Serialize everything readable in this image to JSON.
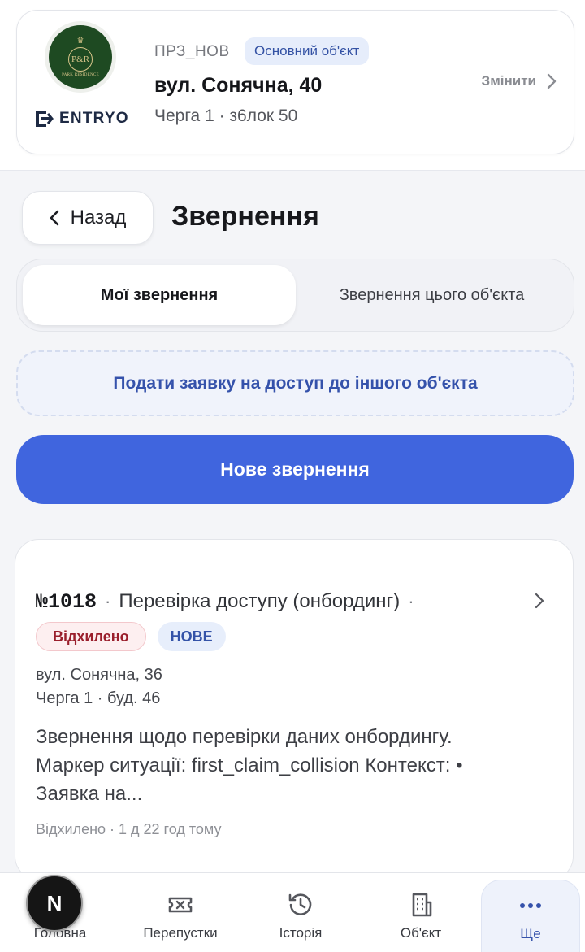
{
  "header": {
    "brand_logo_text": "P&R",
    "brand_logo_sub": "PARK RESIDENCE",
    "platform_name": "ENTRYO",
    "object_code": "ПРЗ_НОВ",
    "object_badge": "Основний об'єкт",
    "address": "вул. Сонячна, 40",
    "queue": "Черга 1 · з6лок 50",
    "change_label": "Змінити"
  },
  "title_bar": {
    "back_label": "Назад",
    "title": "Звернення"
  },
  "tabs": [
    {
      "label": "Мої звернення",
      "active": true
    },
    {
      "label": "Звернення цього об'єкта",
      "active": false
    }
  ],
  "access_link": "Подати заявку на доступ до іншого об'єкта",
  "new_request_label": "Нове звернення",
  "request": {
    "number": "№1018",
    "separator": "·",
    "type": "Перевірка доступу (онбординг)",
    "trailing_separator": "·",
    "status_badge": "Відхилено",
    "new_badge": "НОВЕ",
    "address": "вул. Сонячна, 36",
    "queue": "Черга 1 · буд. 46",
    "description": "Звернення щодо перевірки даних онбордингу. Маркер ситуації: first_claim_collision Контекст: • Заявка на...",
    "meta": "Відхилено · 1 д 22 год тому"
  },
  "bottom_nav": [
    {
      "label": "Головна",
      "icon": "home-icon"
    },
    {
      "label": "Перепустки",
      "icon": "ticket-icon"
    },
    {
      "label": "Історія",
      "icon": "history-icon"
    },
    {
      "label": "Об'єкт",
      "icon": "building-icon"
    },
    {
      "label": "Ще",
      "icon": "more-icon",
      "active": true
    }
  ],
  "avatar_letter": "N",
  "colors": {
    "accent": "#4065de",
    "badge_blue_bg": "#e6edfb",
    "rejected_text": "#9a1f2c",
    "background": "#f4f5f8"
  }
}
